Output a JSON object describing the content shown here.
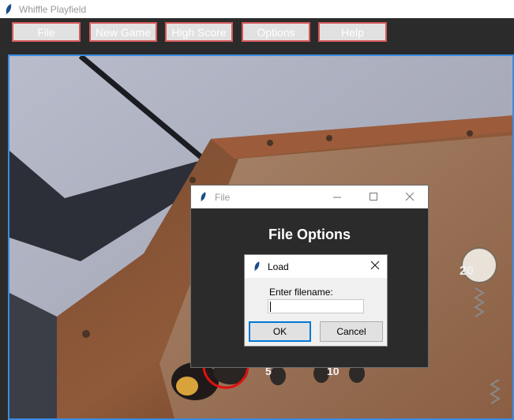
{
  "window": {
    "title": "Whiffle Playfield"
  },
  "toolbar": {
    "buttons": [
      {
        "label": "File"
      },
      {
        "label": "New Game"
      },
      {
        "label": "High Score"
      },
      {
        "label": "Options"
      },
      {
        "label": "Help"
      }
    ]
  },
  "file_dialog": {
    "title": "File",
    "heading": "File Options"
  },
  "load_dialog": {
    "title": "Load",
    "prompt": "Enter filename:",
    "filename_value": "",
    "ok_label": "OK",
    "cancel_label": "Cancel"
  },
  "playfield": {
    "visible_numbers": [
      "20",
      "5",
      "10"
    ]
  },
  "colors": {
    "toolbar_bg": "#2b2b2b",
    "button_border": "#d45a5a",
    "playfield_border": "#3c8be0",
    "marker_circle": "#e01010"
  },
  "icons": [
    "feather-icon",
    "minimize-icon",
    "maximize-icon",
    "close-icon"
  ]
}
